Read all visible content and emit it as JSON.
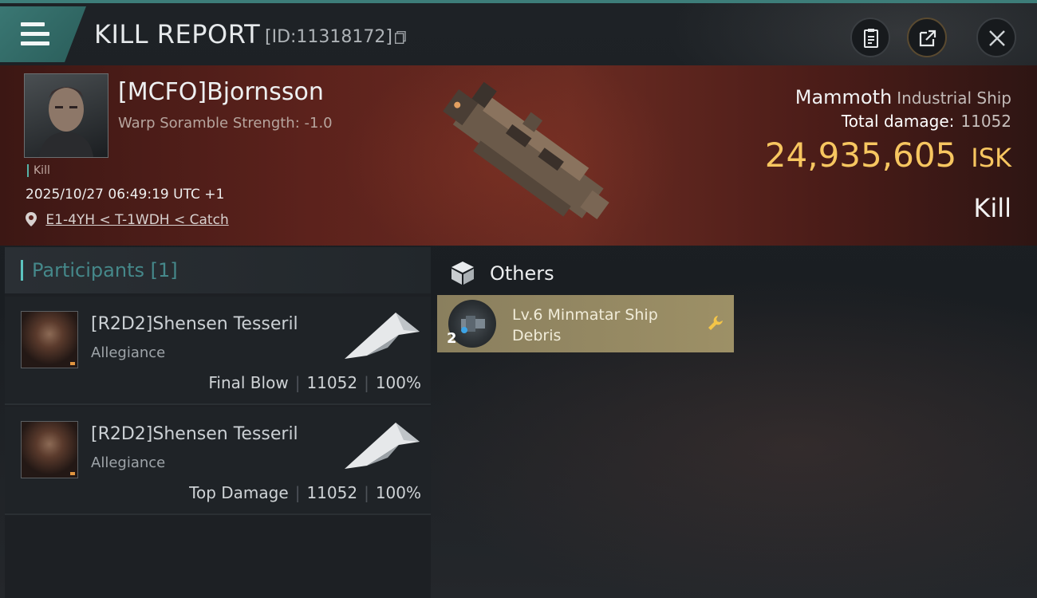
{
  "header": {
    "title": "KILL REPORT",
    "report_id": "[ID:11318172]",
    "icons": [
      "menu-icon",
      "copy-icon",
      "clipboard-icon",
      "share-icon",
      "close-icon"
    ]
  },
  "victim": {
    "name": "[MCFO]Bjornsson",
    "warp_scramble": "Warp Soramble Strength: -1.0",
    "kill_tag": "Kill",
    "datetime": "2025/10/27 06:49:19 UTC +1",
    "location": "E1-4YH < T-1WDH < Catch"
  },
  "ship": {
    "name": "Mammoth",
    "class": "Industrial Ship",
    "total_damage_label": "Total damage:",
    "total_damage_value": "11052",
    "isk_value": "24,935,605",
    "isk_unit": "ISK",
    "outcome": "Kill"
  },
  "participants": {
    "header": "Participants [1]",
    "rows": [
      {
        "name": "[R2D2]Shensen Tesseril",
        "corp": "Allegiance",
        "role": "Final Blow",
        "damage": "11052",
        "percent": "100%"
      },
      {
        "name": "[R2D2]Shensen Tesseril",
        "corp": "Allegiance",
        "role": "Top Damage",
        "damage": "11052",
        "percent": "100%"
      }
    ]
  },
  "others": {
    "header": "Others",
    "items": [
      {
        "name": "Lv.6 Minmatar Ship Debris",
        "qty": "2"
      }
    ]
  },
  "colors": {
    "accent": "#3d7d79",
    "isk": "#f7c660",
    "item_card": "#9d9066"
  }
}
